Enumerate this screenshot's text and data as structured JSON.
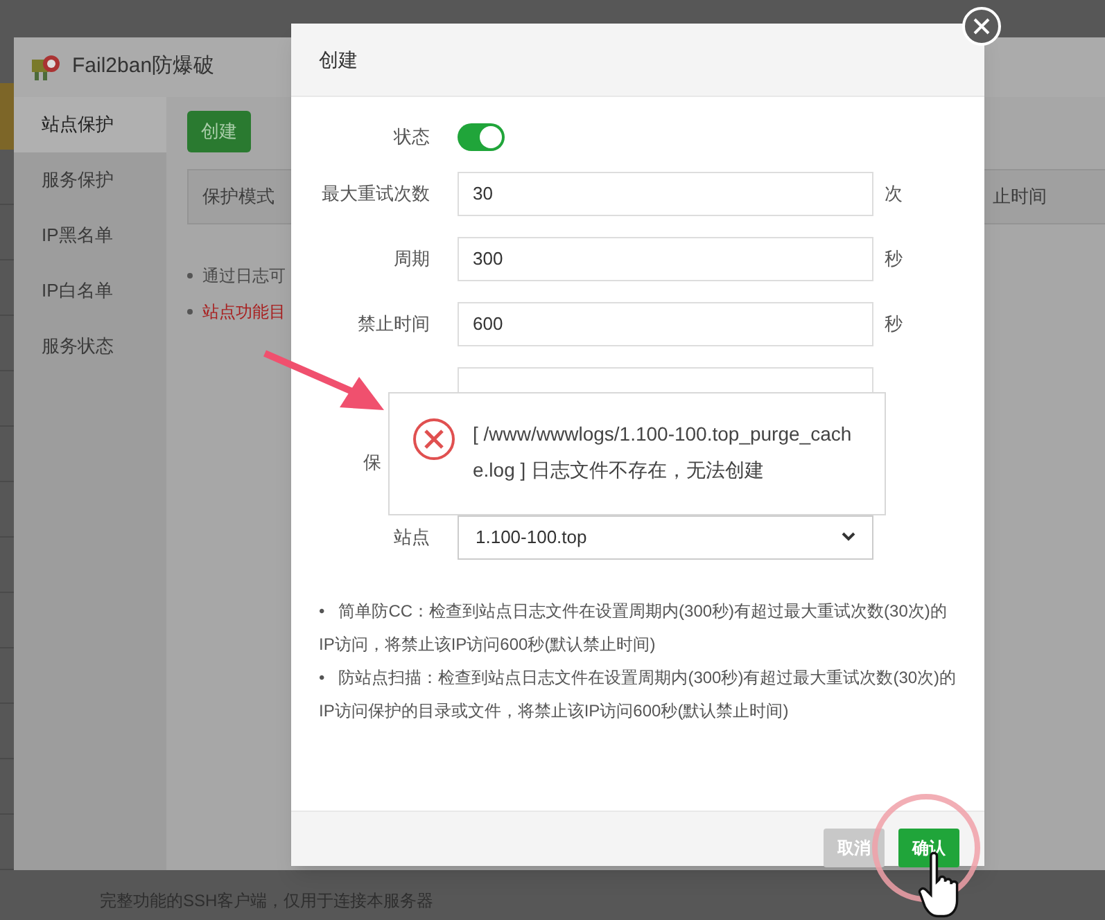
{
  "background_app": {
    "title": "Fail2ban防爆破",
    "sidebar": [
      {
        "label": "站点保护",
        "selected": true
      },
      {
        "label": "服务保护",
        "selected": false
      },
      {
        "label": "IP黑名单",
        "selected": false
      },
      {
        "label": "IP白名单",
        "selected": false
      },
      {
        "label": "服务状态",
        "selected": false
      }
    ],
    "create_button": "创建",
    "table": {
      "columns": [
        "保护模式",
        "止时间"
      ]
    },
    "notes": [
      {
        "text": "通过日志可",
        "kind": "normal"
      },
      {
        "text": "站点功能目",
        "kind": "warning"
      }
    ],
    "footer_text": "完整功能的SSH客户端，仅用于连接本服务器"
  },
  "dialog": {
    "title": "创建",
    "fields": [
      {
        "kind": "toggle",
        "label": "状态",
        "on": true
      },
      {
        "kind": "input",
        "label": "最大重试次数",
        "value": "30",
        "unit": "次"
      },
      {
        "kind": "input",
        "label": "周期",
        "value": "300",
        "unit": "秒"
      },
      {
        "kind": "input",
        "label": "禁止时间",
        "value": "600",
        "unit": "秒"
      },
      {
        "kind": "covered"
      },
      {
        "kind": "partial",
        "label": "保"
      },
      {
        "kind": "select",
        "label": "站点",
        "value": "1.100-100.top"
      }
    ],
    "notes": [
      "•   简单防CC：检查到站点日志文件在设置周期内(300秒)有超过最大重试次数(30次)的IP访问，将禁止该IP访问600秒(默认禁止时间)",
      "•   防站点扫描：检查到站点日志文件在设置周期内(300秒)有超过最大重试次数(30次)的IP访问保护的目录或文件，将禁止该IP访问600秒(默认禁止时间)"
    ],
    "buttons": [
      {
        "label": "取消",
        "kind": "cancel"
      },
      {
        "label": "确认",
        "kind": "primary"
      }
    ]
  },
  "toast": {
    "kind": "error",
    "message": "[ /www/wwwlogs/1.100-100.top_purge_cache.log ] 日志文件不存在，无法创建"
  }
}
